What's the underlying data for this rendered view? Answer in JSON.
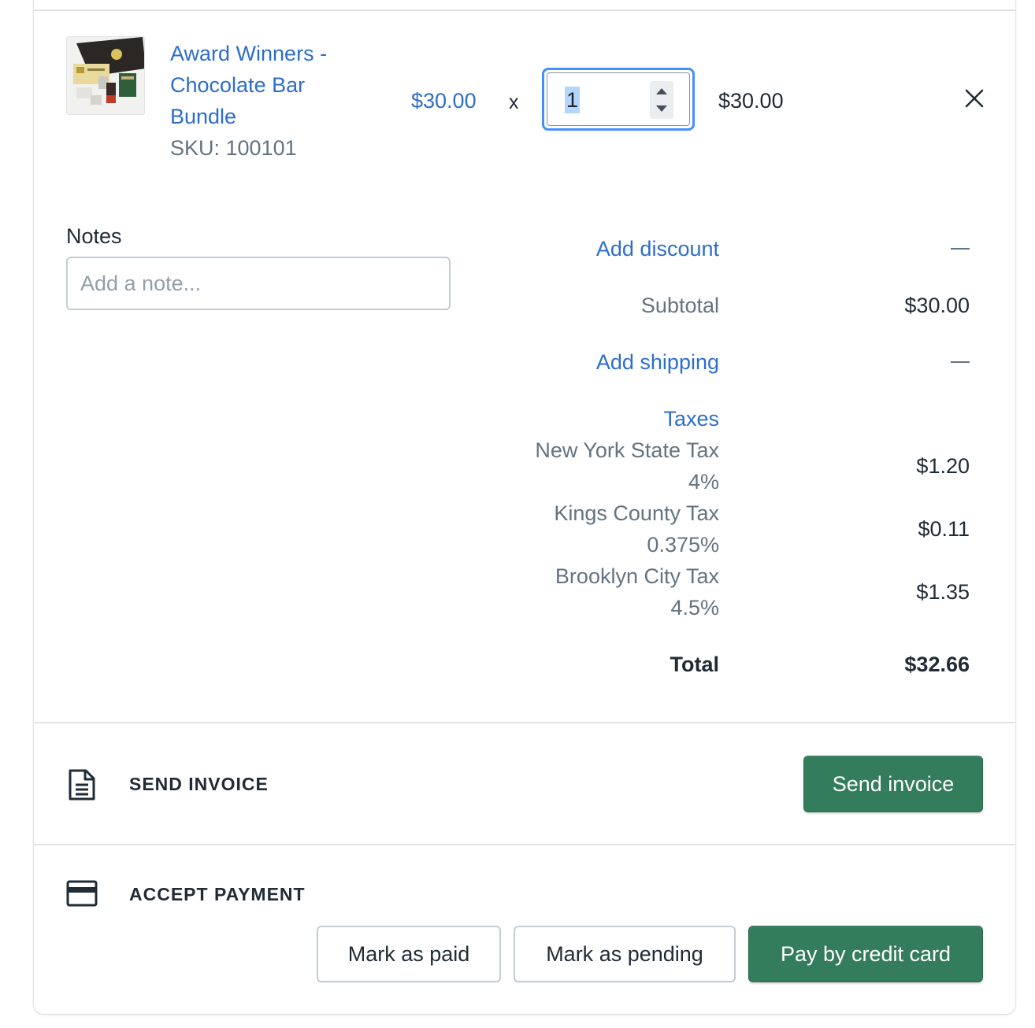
{
  "line_item": {
    "title": "Award Winners - Chocolate Bar Bundle",
    "sku": "SKU: 100101",
    "unit_price": "$30.00",
    "times": "x",
    "quantity": "1",
    "line_total": "$30.00",
    "remove_icon": "close-icon"
  },
  "notes": {
    "label": "Notes",
    "placeholder": "Add a note..."
  },
  "summary": {
    "add_discount": "Add discount",
    "discount_value": "—",
    "subtotal_label": "Subtotal",
    "subtotal_value": "$30.00",
    "add_shipping": "Add shipping",
    "shipping_value": "—",
    "taxes_label": "Taxes",
    "taxes": [
      {
        "name": "New York State Tax",
        "rate": "4%",
        "amount": "$1.20"
      },
      {
        "name": "Kings County Tax",
        "rate": "0.375%",
        "amount": "$0.11"
      },
      {
        "name": "Brooklyn City Tax",
        "rate": "4.5%",
        "amount": "$1.35"
      }
    ],
    "total_label": "Total",
    "total_value": "$32.66"
  },
  "send_invoice": {
    "icon": "document-icon",
    "title": "SEND INVOICE",
    "button": "Send invoice"
  },
  "accept_payment": {
    "icon": "credit-card-icon",
    "title": "ACCEPT PAYMENT",
    "mark_paid": "Mark as paid",
    "mark_pending": "Mark as pending",
    "pay_card": "Pay by credit card"
  },
  "colors": {
    "link": "#2c6ecb",
    "primary_button": "#347d5c",
    "focus_ring": "#458fff"
  }
}
